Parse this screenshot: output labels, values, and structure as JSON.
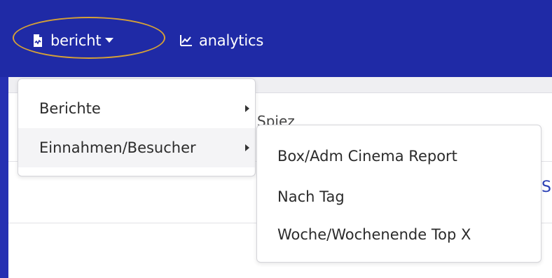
{
  "navbar": {
    "bericht_label": "bericht",
    "analytics_label": "analytics"
  },
  "page": {
    "text_fragment": "Spiez",
    "link_fragment": "S"
  },
  "dropdown": {
    "items": [
      {
        "label": "Berichte"
      },
      {
        "label": "Einnahmen/Besucher"
      }
    ]
  },
  "submenu": {
    "items": [
      {
        "label": "Box/Adm Cinema Report"
      },
      {
        "label": "Nach Tag"
      },
      {
        "label": "Woche/Wochenende Top X"
      }
    ]
  },
  "colors": {
    "navbar": "#1f2aa6",
    "highlight": "#d6a136",
    "link": "#2a3fb5"
  },
  "icons": {
    "bericht": "file-chart-icon",
    "analytics": "line-chart-icon"
  }
}
